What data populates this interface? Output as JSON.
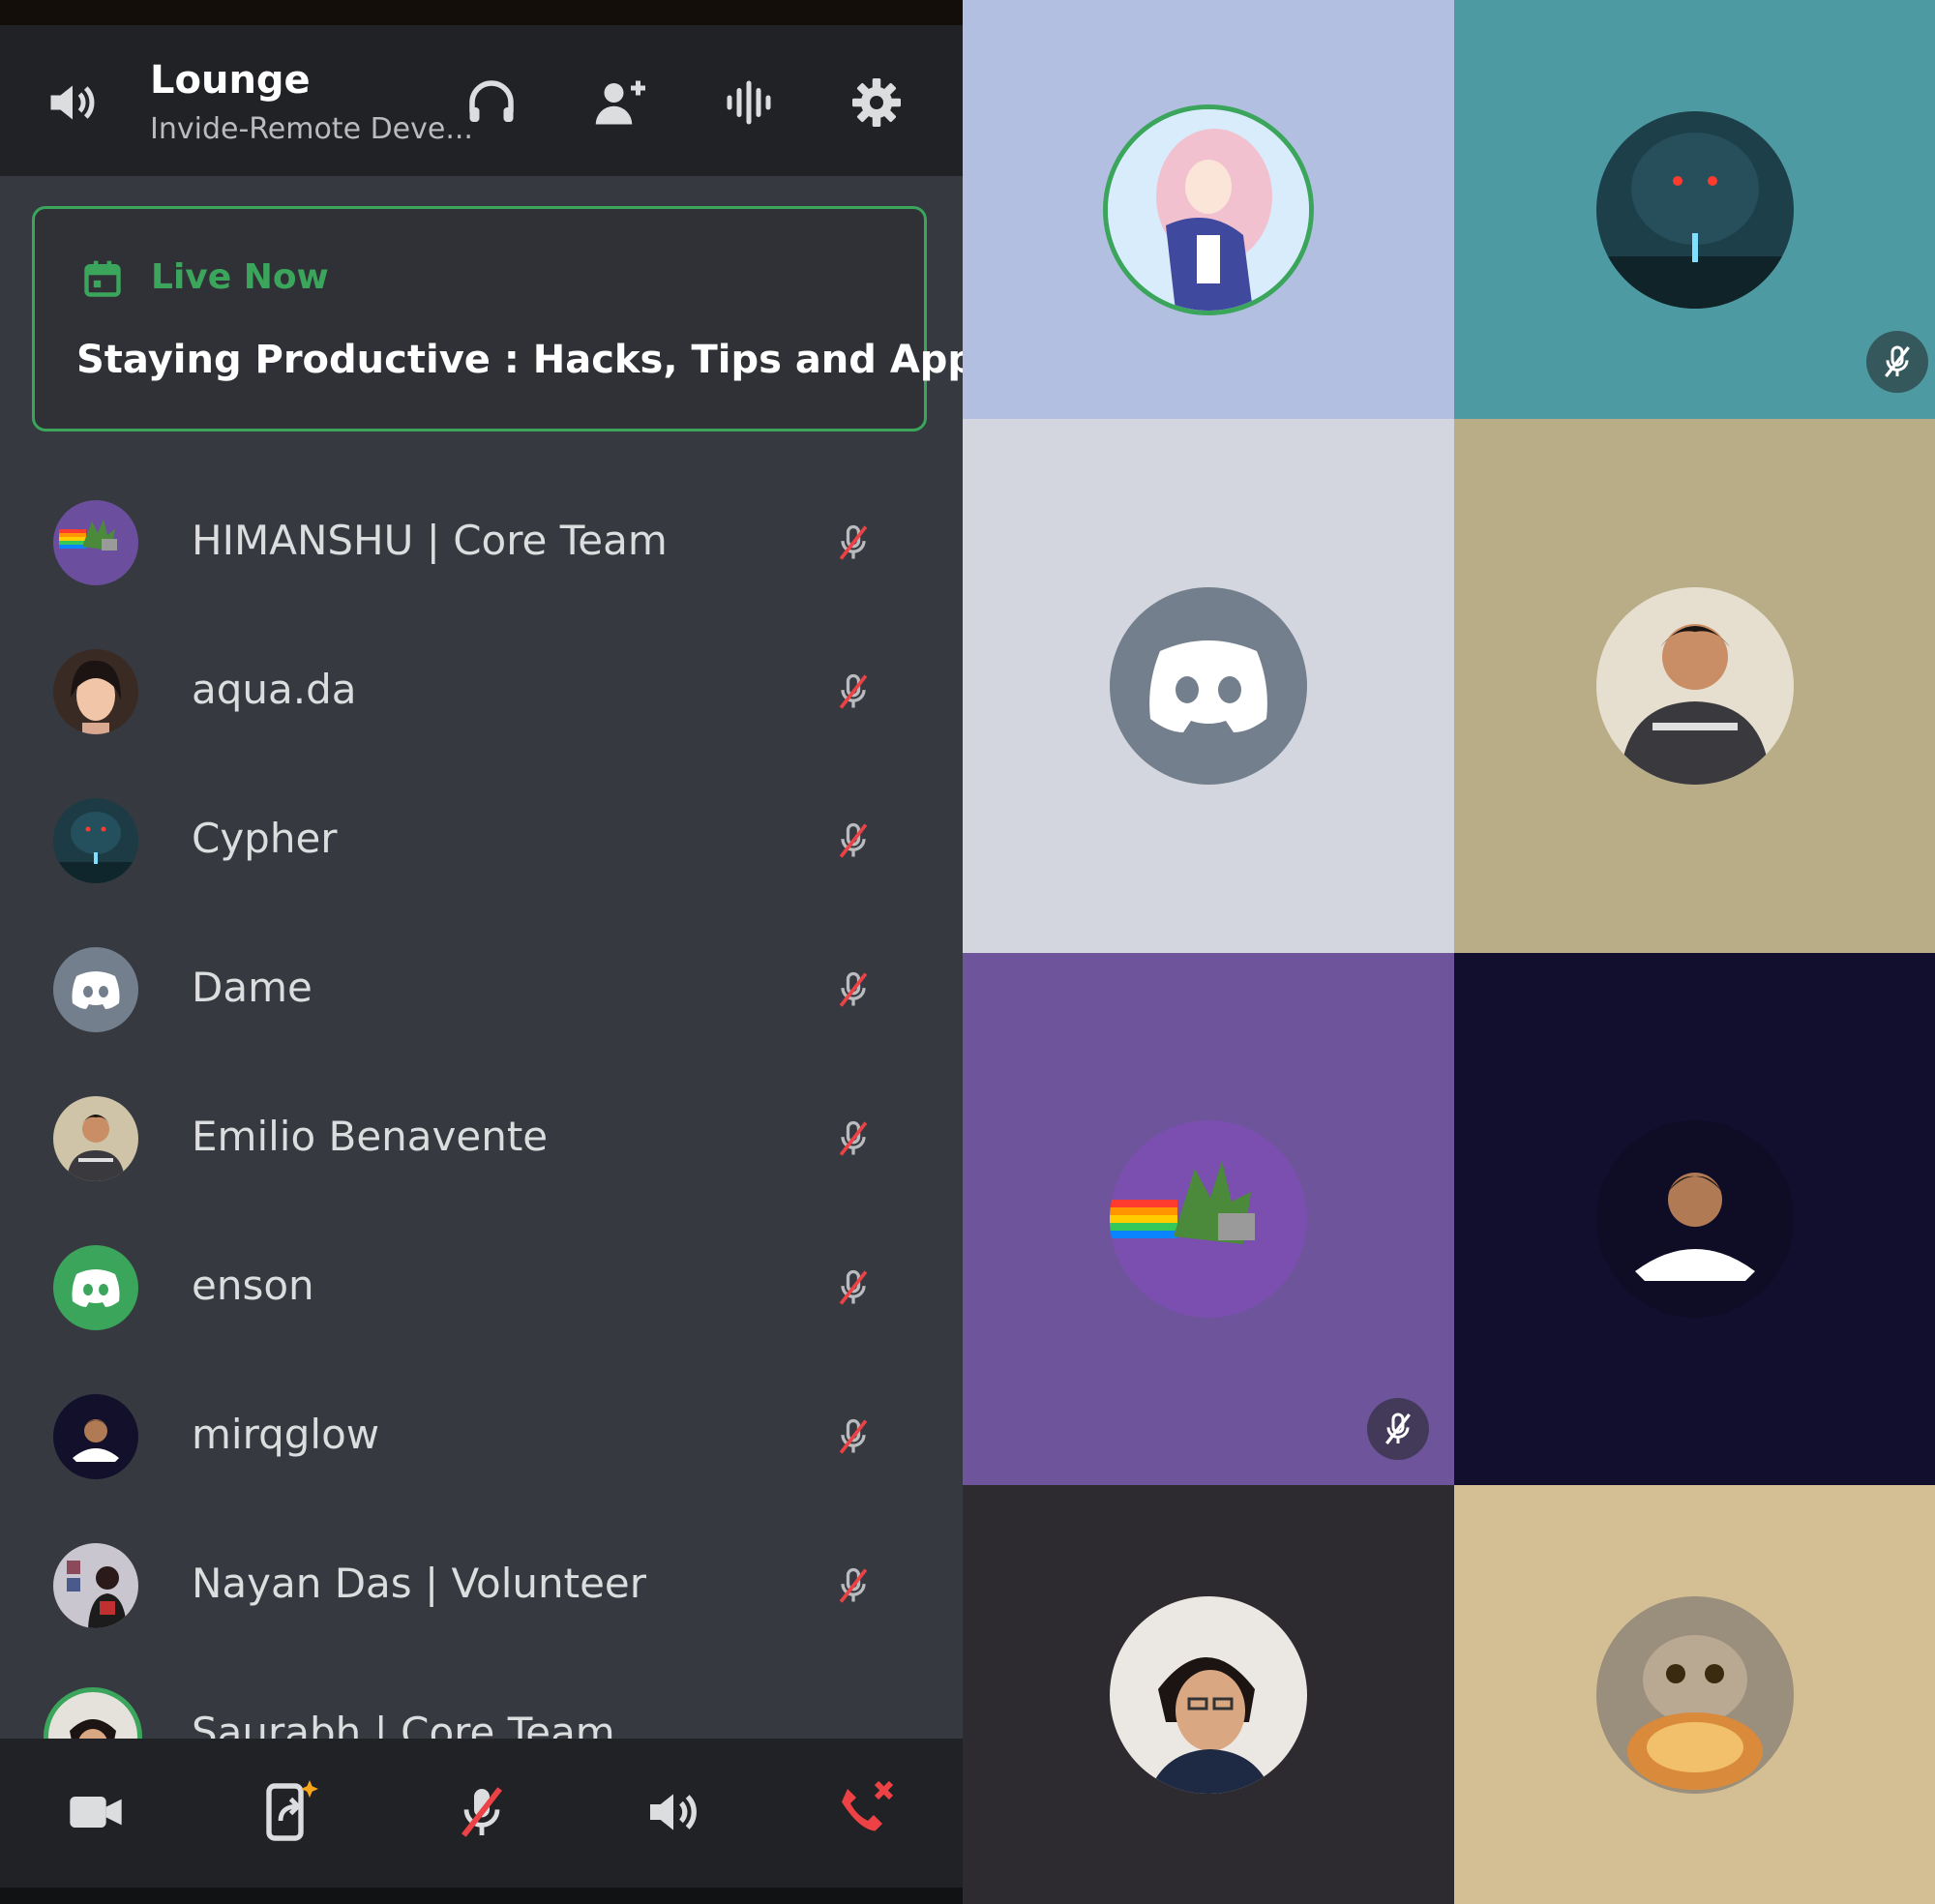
{
  "header": {
    "channel_name": "Lounge",
    "server_name": "Invide-Remote Deve..."
  },
  "live": {
    "label": "Live Now",
    "title": "Staying Productive : Hacks, Tips and Apps"
  },
  "members": [
    {
      "name": "HIMANSHU | Core Team"
    },
    {
      "name": "aqua.da"
    },
    {
      "name": "Cypher"
    },
    {
      "name": "Dame"
    },
    {
      "name": "Emilio Benavente"
    },
    {
      "name": "enson"
    },
    {
      "name": "mirqglow"
    },
    {
      "name": "Nayan Das | Volunteer"
    },
    {
      "name": "Saurabh | Core Team"
    }
  ],
  "colors": {
    "accent_green": "#3ba55c",
    "danger_red": "#ed4245",
    "tile_colors": [
      "#b3bfe0",
      "#4e9aa2",
      "#d3d6de",
      "#b9ad88",
      "#6e549a",
      "#120f2e",
      "#2d2a30",
      "#d4bf94"
    ]
  },
  "icons": {
    "header": [
      "speaker-icon",
      "headphones-icon",
      "add-user-icon",
      "voice-activity-icon",
      "gear-icon"
    ],
    "bottom": [
      "camera-icon",
      "screen-share-icon",
      "mute-mic-icon",
      "speaker-icon",
      "hang-up-icon"
    ]
  }
}
